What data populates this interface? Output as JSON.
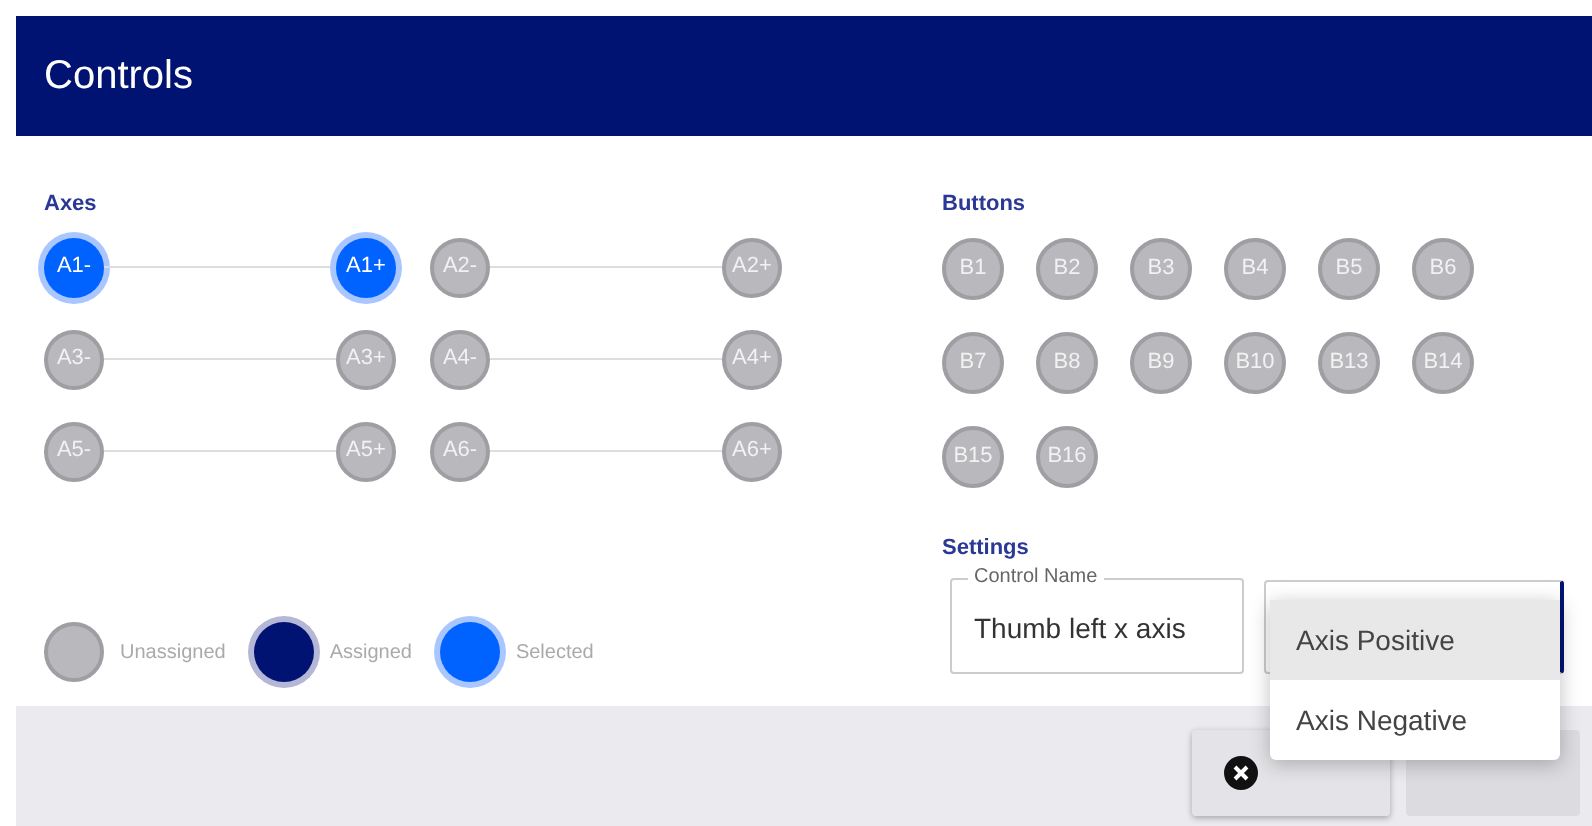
{
  "window": {
    "title": "Controls"
  },
  "axes": {
    "label": "Axes",
    "pairs": [
      {
        "negative": {
          "label": "A1-",
          "selected": true,
          "assigned": false
        },
        "positive": {
          "label": "A1+",
          "selected": true,
          "assigned": false
        }
      },
      {
        "negative": {
          "label": "A2-",
          "selected": false,
          "assigned": false
        },
        "positive": {
          "label": "A2+",
          "selected": false,
          "assigned": false
        }
      },
      {
        "negative": {
          "label": "A3-",
          "selected": false,
          "assigned": false
        },
        "positive": {
          "label": "A3+",
          "selected": false,
          "assigned": false
        }
      },
      {
        "negative": {
          "label": "A4-",
          "selected": false,
          "assigned": false
        },
        "positive": {
          "label": "A4+",
          "selected": false,
          "assigned": false
        }
      },
      {
        "negative": {
          "label": "A5-",
          "selected": false,
          "assigned": false
        },
        "positive": {
          "label": "A5+",
          "selected": false,
          "assigned": false
        }
      },
      {
        "negative": {
          "label": "A6-",
          "selected": false,
          "assigned": false
        },
        "positive": {
          "label": "A6+",
          "selected": false,
          "assigned": false
        }
      }
    ]
  },
  "buttons": {
    "label": "Buttons",
    "items": [
      {
        "label": "B1",
        "selected": false,
        "assigned": false
      },
      {
        "label": "B2",
        "selected": false,
        "assigned": false
      },
      {
        "label": "B3",
        "selected": false,
        "assigned": false
      },
      {
        "label": "B4",
        "selected": false,
        "assigned": false
      },
      {
        "label": "B5",
        "selected": false,
        "assigned": false
      },
      {
        "label": "B6",
        "selected": false,
        "assigned": false
      },
      {
        "label": "B7",
        "selected": false,
        "assigned": false
      },
      {
        "label": "B8",
        "selected": false,
        "assigned": false
      },
      {
        "label": "B9",
        "selected": false,
        "assigned": false
      },
      {
        "label": "B10",
        "selected": false,
        "assigned": false
      },
      {
        "label": "B13",
        "selected": false,
        "assigned": false
      },
      {
        "label": "B14",
        "selected": false,
        "assigned": false
      },
      {
        "label": "B15",
        "selected": false,
        "assigned": false
      },
      {
        "label": "B16",
        "selected": false,
        "assigned": false
      }
    ]
  },
  "legend": [
    {
      "label": "Unassigned",
      "kind": "unassigned"
    },
    {
      "label": "Assigned",
      "kind": "assigned"
    },
    {
      "label": "Selected",
      "kind": "selected"
    }
  ],
  "settings": {
    "label": "Settings",
    "control_name": {
      "label": "Control Name",
      "value": "Thumb left x axis"
    },
    "menu": [
      {
        "label": "Axis Positive",
        "selected": true
      },
      {
        "label": "Axis Negative",
        "selected": false
      }
    ]
  },
  "footer_buttons": [
    {
      "kind": "cancel",
      "disabled": false
    },
    {
      "kind": "assign",
      "disabled": true
    }
  ]
}
